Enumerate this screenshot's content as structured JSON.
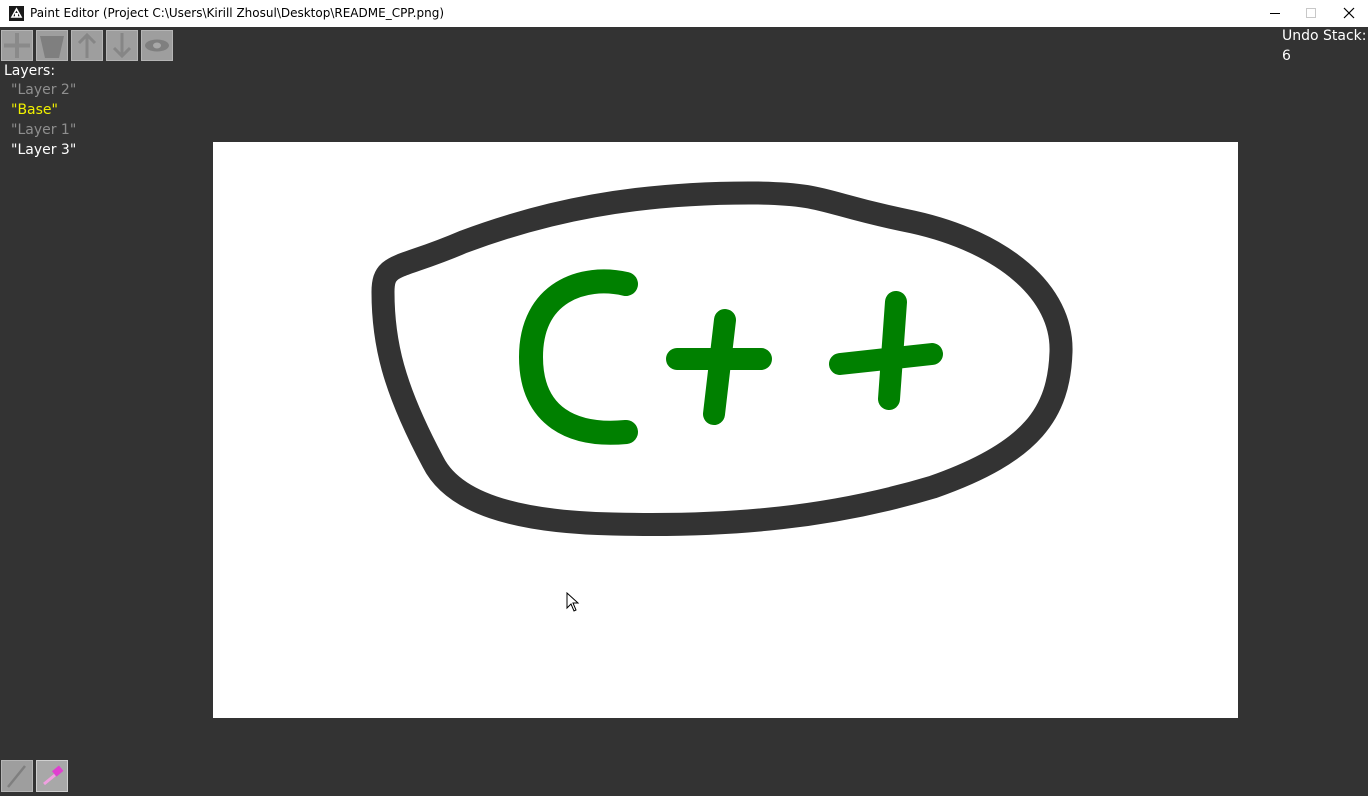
{
  "window": {
    "title": "Paint Editor (Project C:\\Users\\Kirill Zhosul\\Desktop\\README_CPP.png)"
  },
  "toolbar": {
    "buttons": [
      {
        "name": "add-layer",
        "icon": "plus-icon"
      },
      {
        "name": "delete-layer",
        "icon": "trash-icon"
      },
      {
        "name": "move-layer-up",
        "icon": "arrow-up-icon"
      },
      {
        "name": "move-layer-down",
        "icon": "arrow-down-icon"
      },
      {
        "name": "toggle-visibility",
        "icon": "eye-icon"
      }
    ]
  },
  "layers": {
    "label": "Layers:",
    "items": [
      {
        "label": "\"Layer 2\"",
        "state": "hidden"
      },
      {
        "label": "\"Base\"",
        "state": "selected"
      },
      {
        "label": "\"Layer 1\"",
        "state": "hidden"
      },
      {
        "label": "\"Layer 3\"",
        "state": "visible"
      }
    ]
  },
  "undo": {
    "label": "Undo Stack:",
    "count": "6"
  },
  "tools": {
    "brush_icon": "brush-icon",
    "eraser_icon": "eraser-icon"
  },
  "colors": {
    "background": "#333333",
    "canvas": "#ffffff",
    "stroke_dark": "#333333",
    "stroke_green": "#008000",
    "selected_layer": "#f0f000",
    "hidden_layer": "#8e8e8e"
  }
}
